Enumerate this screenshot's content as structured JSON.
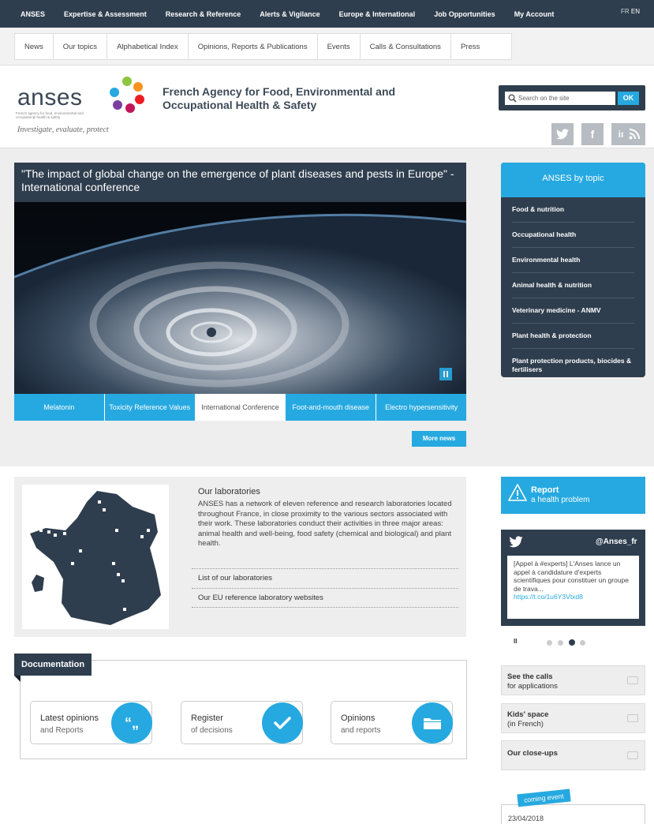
{
  "top_nav": {
    "items": [
      "ANSES",
      "Expertise & Assessment",
      "Research & Reference",
      "Alerts & Vigilance",
      "Europe & International",
      "Job Opportunities",
      "My Account"
    ],
    "lang_fr": "FR",
    "lang_en": "EN"
  },
  "secondary_nav": {
    "items": [
      "News",
      "Our topics",
      "Alphabetical Index",
      "Opinions, Reports & Publications",
      "Events",
      "Calls & Consultations",
      "Press"
    ]
  },
  "header": {
    "logo_text": "anses",
    "logo_subtitle": "French agency for food, environmental and occupational health & safety",
    "tagline": "Investigate, evaluate, protect",
    "org_name": "French Agency for Food, Environmental and Occupational Health & Safety",
    "search_placeholder": "Search on the site",
    "search_button": "OK",
    "social": [
      "twitter-icon",
      "facebook-icon",
      "linkedin-icon",
      "rss-icon"
    ]
  },
  "hero": {
    "title": "\"The impact of global change on the emergence of plant diseases and pests in Europe\" - International conference",
    "tabs": [
      {
        "label": "Melatonin",
        "active": false
      },
      {
        "label": "Toxicity Reference Values",
        "active": false
      },
      {
        "label": "International Conference",
        "active": true
      },
      {
        "label": "Foot-and-mouth disease",
        "active": false
      },
      {
        "label": "Electro hypersensitivity",
        "active": false
      }
    ],
    "more_news": "More news"
  },
  "topics": {
    "title": "ANSES by topic",
    "items": [
      "Food & nutrition",
      "Occupational health",
      "Environmental health",
      "Animal health & nutrition",
      "Veterinary medicine - ANMV",
      "Plant health & protection",
      "Plant protection products, biocides & fertilisers"
    ]
  },
  "labs": {
    "title": "Our laboratories",
    "text": "ANSES has a network of eleven reference and research laboratories located throughout France, in close proximity to the various sectors associated with their work. These laboratories conduct their activities in three major areas: animal health and well-being, food safety (chemical and biological) and plant health.",
    "link1": "List of our laboratories",
    "link2": "Our EU reference laboratory websites"
  },
  "report": {
    "line1": "Report",
    "line2": "a health problem"
  },
  "twitter": {
    "handle": "@Anses_fr",
    "tweet": "[Appel à #experts] L'Anses lance un appel à candidature d'experts scientifiques pour constituer un groupe de trava...",
    "link": "https://t.co/1u6Y3Vtxd8"
  },
  "carousel": {
    "pause": "II",
    "active_index": 2,
    "count": 4
  },
  "side_boxes": [
    {
      "l1": "See the calls",
      "l2": "for applications"
    },
    {
      "l1": "Kids' space",
      "l2": "(in French)"
    },
    {
      "l1": "Our close-ups",
      "l2": ""
    }
  ],
  "documentation": {
    "title": "Documentation",
    "cards": [
      {
        "l1": "Latest opinions",
        "l2": "and Reports",
        "icon": "quote-icon"
      },
      {
        "l1": "Register",
        "l2": "of decisions",
        "icon": "checkmark-icon"
      },
      {
        "l1": "Opinions",
        "l2": "and reports",
        "icon": "folder-icon"
      }
    ]
  },
  "event": {
    "tag": "coming event",
    "date": "23/04/2018"
  },
  "colors": {
    "dark": "#2f3e4e",
    "accent": "#26a9e0"
  }
}
